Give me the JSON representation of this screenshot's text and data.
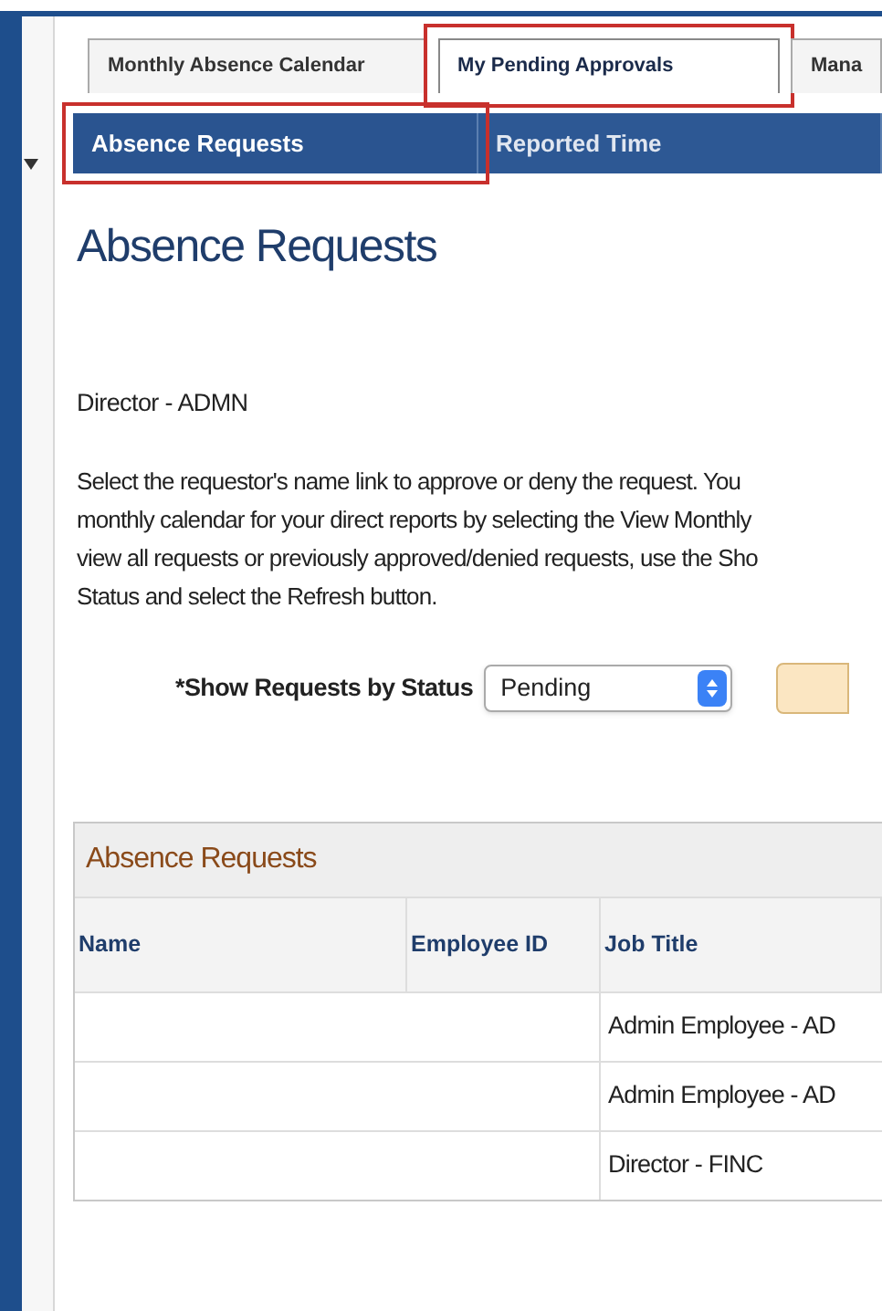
{
  "tabs": [
    {
      "label": "Monthly Absence Calendar",
      "selected": false,
      "highlighted": false
    },
    {
      "label": "My Pending Approvals",
      "selected": true,
      "highlighted": true
    },
    {
      "label": "Mana",
      "selected": false,
      "highlighted": false
    }
  ],
  "subtabs": [
    {
      "label": "Absence Requests",
      "selected": true,
      "highlighted": true
    },
    {
      "label": "Reported Time",
      "selected": false,
      "highlighted": false
    }
  ],
  "page_title": "Absence Requests",
  "role": "Director - ADMN",
  "instructions": [
    "Select the requestor's name link to approve or deny the request. You",
    "monthly calendar for your direct reports by selecting the View Monthly",
    "view all requests or previously approved/denied requests, use the Sho",
    "Status and select the Refresh button."
  ],
  "filter": {
    "label": "*Show Requests by Status",
    "value": "Pending"
  },
  "table": {
    "title": "Absence Requests",
    "columns": [
      "Name",
      "Employee ID",
      "Job Title"
    ],
    "rows": [
      {
        "job_title": "Admin Employee - AD"
      },
      {
        "job_title": "Admin Employee - AD"
      },
      {
        "job_title": "Director - FINC"
      }
    ]
  }
}
